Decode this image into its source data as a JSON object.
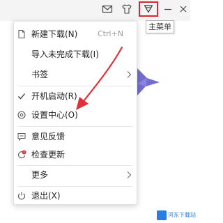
{
  "titlebar": {
    "icons": [
      "mail-icon",
      "tshirt-icon",
      "main-menu-icon",
      "minimize-icon",
      "close-icon"
    ],
    "tooltip": "主菜单"
  },
  "menu": {
    "items": [
      {
        "label": "新建下载(N)",
        "shortcut": "Ctrl+N",
        "icon": "new-file-icon"
      },
      {
        "label": "导入未完成下载(I)"
      },
      {
        "label": "书签",
        "submenu": true
      },
      {
        "label": "开机启动(R)",
        "icon": "check-icon",
        "checked": true
      },
      {
        "label": "设置中心(O)",
        "icon": "settings-icon"
      },
      {
        "label": "意见反馈",
        "icon": "feedback-icon"
      },
      {
        "label": "检查更新",
        "icon": "update-icon"
      },
      {
        "label": "更多",
        "submenu": true
      },
      {
        "label": "退出(X)",
        "icon": "power-icon"
      }
    ]
  },
  "colors": {
    "highlight": "#d9262f",
    "arrow": "#e0303a",
    "accent": "#2a7de1"
  },
  "watermark": {
    "text": "河东下载站"
  }
}
